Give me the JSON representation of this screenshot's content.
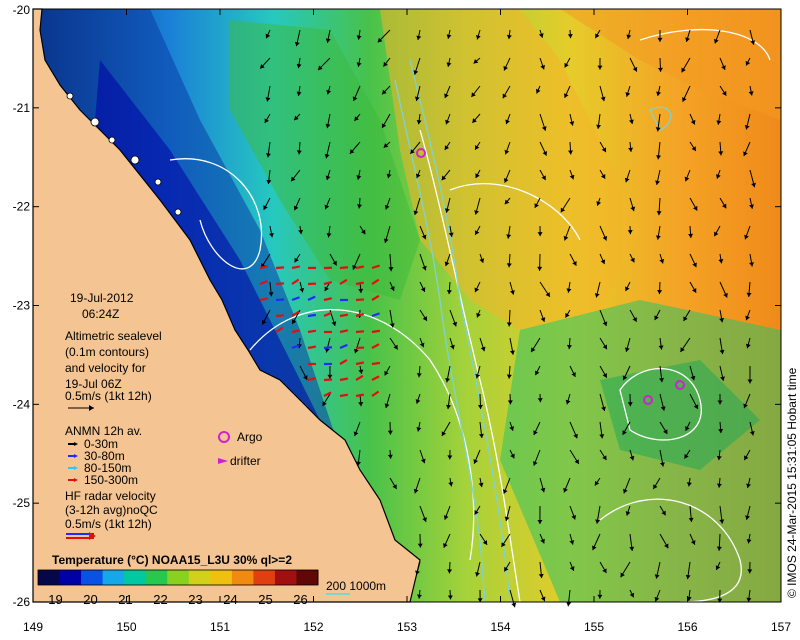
{
  "map": {
    "lon_ticks": [
      "149",
      "150",
      "151",
      "152",
      "153",
      "154",
      "155",
      "156",
      "157"
    ],
    "lat_ticks": [
      "-20",
      "-21",
      "-22",
      "-23",
      "-24",
      "-25",
      "-26"
    ],
    "lon_range": [
      149,
      157
    ],
    "lat_range": [
      -26,
      -20
    ],
    "colors": {
      "land": "#f4c592",
      "coast": "#000000",
      "contour": "#ffffff",
      "isobath": "#7fd3d0"
    }
  },
  "legend": {
    "date": "19-Jul-2012",
    "time": "06:24Z",
    "altimetry": [
      "Altimetric sealevel",
      "(0.1m contours)",
      "and velocity for",
      "19-Jul 06Z"
    ],
    "scale_label": "0.5m/s (1kt 12h)",
    "anmn_title": "ANMN 12h av.",
    "anmn": [
      {
        "label": "0-30m",
        "color": "#000000"
      },
      {
        "label": "30-80m",
        "color": "#1f2bff"
      },
      {
        "label": "80-150m",
        "color": "#28c8ff"
      },
      {
        "label": "150-300m",
        "color": "#e01010"
      }
    ],
    "argo_label": "Argo",
    "drifter_label": "drifter",
    "hf": [
      "HF radar velocity",
      "(3-12h avg)noQC",
      "0.5m/s (1kt 12h)"
    ],
    "argo_color": "#d020d0"
  },
  "colorbar": {
    "title": "Temperature (°C) NOAA15_L3U 30% ql>=2",
    "ticks": [
      "19",
      "20",
      "21",
      "22",
      "23",
      "24",
      "25",
      "26"
    ],
    "range": [
      18.5,
      26.5
    ],
    "colors": [
      "#06064a",
      "#0000a8",
      "#0a52e6",
      "#14a8ea",
      "#00c8a0",
      "#28c850",
      "#8ad020",
      "#d2d01a",
      "#f0c010",
      "#f08a10",
      "#e04010",
      "#a01010",
      "#600808"
    ]
  },
  "isobath_label": "200  1000m",
  "credit": "© IMOS 24-Mar-2015 15:31:05 Hobart time"
}
